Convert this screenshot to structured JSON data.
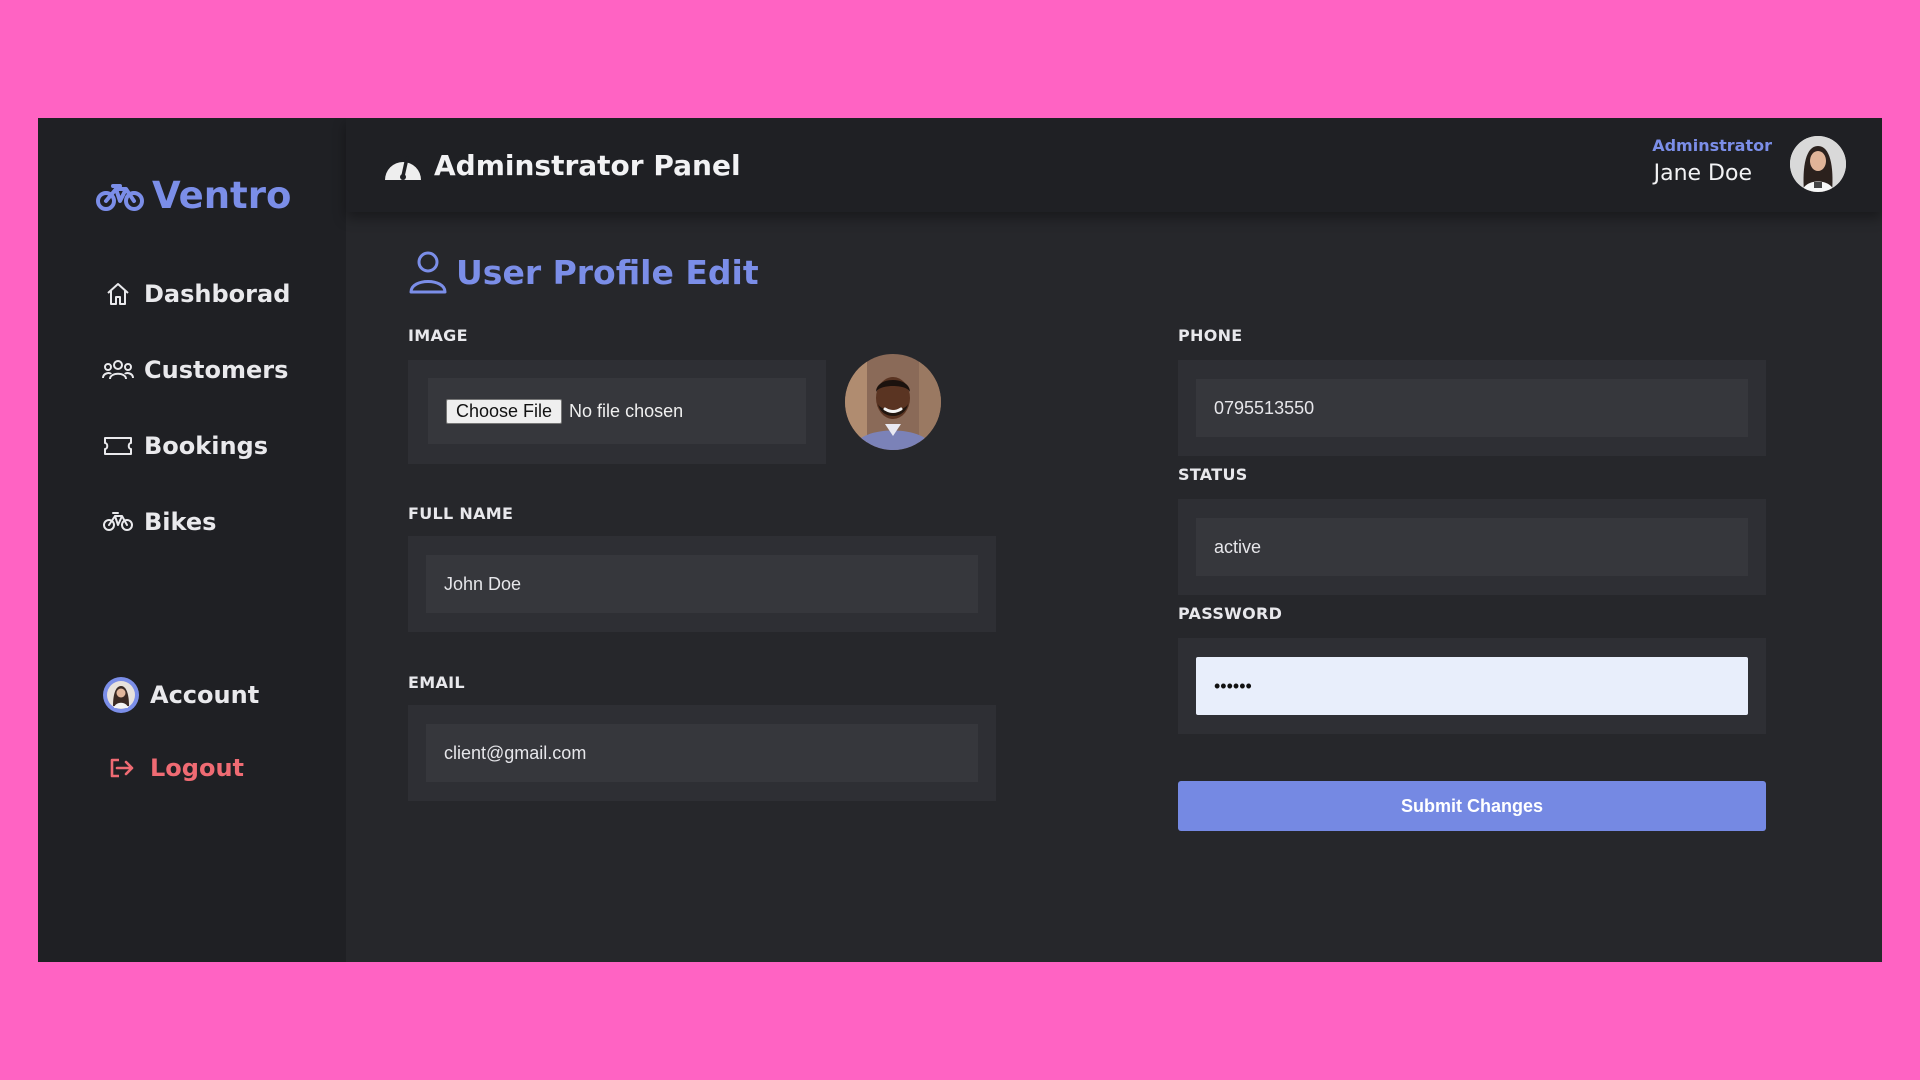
{
  "brand": {
    "name": "Ventro"
  },
  "sidebar": {
    "items": [
      {
        "label": "Dashborad",
        "icon": "home-icon"
      },
      {
        "label": "Customers",
        "icon": "users-icon"
      },
      {
        "label": "Bookings",
        "icon": "ticket-icon"
      },
      {
        "label": "Bikes",
        "icon": "bike-icon"
      }
    ],
    "account_label": "Account",
    "logout_label": "Logout"
  },
  "header": {
    "title": "Adminstrator Panel",
    "user_role": "Adminstrator",
    "user_name": "Jane Doe"
  },
  "form": {
    "title": "User Profile Edit",
    "image": {
      "label": "IMAGE",
      "button_text": "Choose File",
      "status_text": "No file chosen"
    },
    "full_name": {
      "label": "FULL NAME",
      "value": "John Doe"
    },
    "email": {
      "label": "EMAIL",
      "value": "client@gmail.com"
    },
    "phone": {
      "label": "PHONE",
      "value": "0795513550"
    },
    "status": {
      "label": "STATUS",
      "value": "active"
    },
    "password": {
      "label": "PASSWORD",
      "value": "••••••"
    },
    "submit_label": "Submit Changes"
  },
  "colors": {
    "background": "#ff63c3",
    "panel": "#1f2024",
    "content": "#26272b",
    "accent": "#7b8ee8",
    "logout": "#ef6b73",
    "submit": "#7589e3"
  }
}
